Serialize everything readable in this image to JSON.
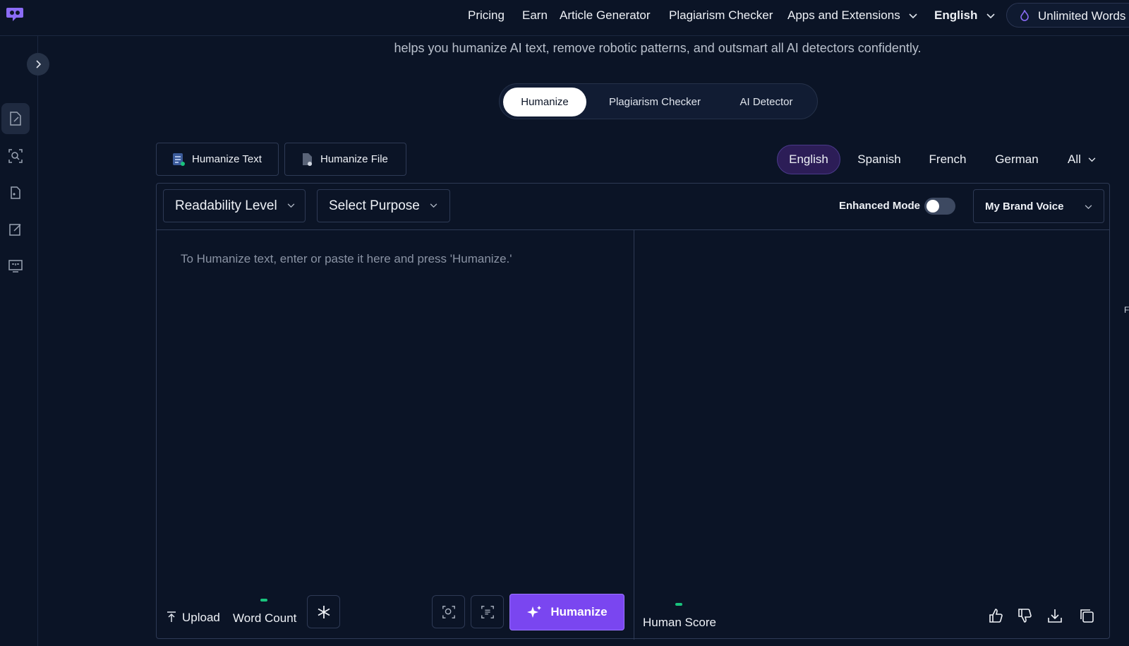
{
  "nav": {
    "links": [
      "Pricing",
      "Earn",
      "Article Generator",
      "Plagiarism Checker",
      "Apps and Extensions"
    ],
    "language": "English",
    "unlimited": "Unlimited Words"
  },
  "header": {
    "subtitle": "helps you humanize AI text, remove robotic patterns, and outsmart all AI detectors confidently."
  },
  "modes": [
    "Humanize",
    "Plagiarism Checker",
    "AI Detector"
  ],
  "source_buttons": [
    "Humanize Text",
    "Humanize File"
  ],
  "languages": [
    "English",
    "Spanish",
    "French",
    "German",
    "All"
  ],
  "toolbar": {
    "readability": "Readability Level",
    "purpose": "Select Purpose",
    "enhanced_mode": "Enhanced Mode",
    "enhanced_on": false,
    "brand_voice": "My Brand Voice"
  },
  "editor": {
    "placeholder": "To Humanize text, enter or paste it here and press 'Humanize.'",
    "upload": "Upload",
    "word_count": "Word Count",
    "humanize_button": "Humanize",
    "human_score": "Human Score"
  },
  "edge_char": "F",
  "colors": {
    "accent": "#7a46f0",
    "background": "#0b1426",
    "status_green": "#19c37d"
  }
}
